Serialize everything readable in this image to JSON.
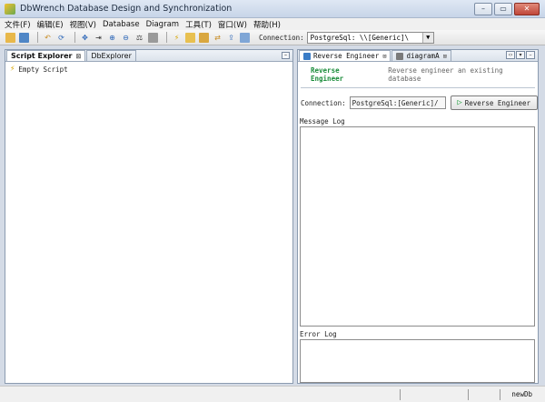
{
  "window": {
    "title": "DbWrench Database Design and Synchronization",
    "controls": [
      "–",
      "▭",
      "✕"
    ]
  },
  "menu": [
    "文件(F)",
    "编辑(E)",
    "视图(V)",
    "Database",
    "Diagram",
    "工具(T)",
    "窗口(W)",
    "帮助(H)"
  ],
  "toolbar": {
    "connection_label": "Connection:",
    "connection_value": "PostgreSql: \\\\[Generic]\\",
    "icons": [
      "open-icon",
      "new-icon",
      "undo-icon",
      "refresh-icon",
      "move-icon",
      "arrow-icon",
      "zoom-in-icon",
      "zoom-out-icon",
      "scale-icon",
      "stop-icon",
      "script-icon",
      "forward-engineer-icon",
      "compare-icon",
      "sync-icon",
      "export-icon",
      "report-icon"
    ]
  },
  "left_panel": {
    "tabs": [
      "Script Explorer",
      "DbExplorer"
    ],
    "tree_item": "Empty Script"
  },
  "right_panel": {
    "tabs": [
      "Reverse Engineer",
      "diagramA"
    ],
    "header_title": "Reverse Engineer",
    "header_desc": "Reverse engineer an existing database",
    "connection_label": "Connection:",
    "connection_value": "PostgreSql:[Generic]/",
    "button_label": "Reverse Engineer",
    "message_log_label": "Message Log",
    "error_log_label": "Error Log"
  },
  "statusbar": {
    "text": "newDb"
  }
}
